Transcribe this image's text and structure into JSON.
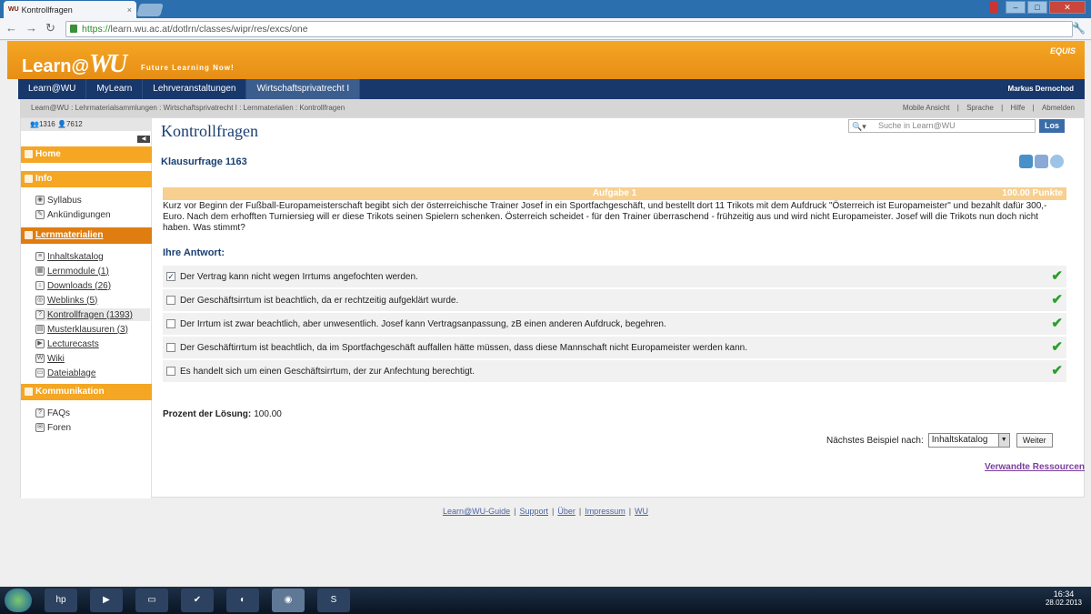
{
  "browser": {
    "tab_title": "Kontrollfragen",
    "tab_favicon": "WU",
    "url_scheme": "https://",
    "url_rest": "learn.wu.ac.at/dotlrn/classes/wipr/res/excs/one"
  },
  "header": {
    "logo_left": "Learn@",
    "logo_wu": "WU",
    "tagline": "Future Learning Now!",
    "equis": "EQUIS"
  },
  "mainnav": {
    "items": [
      "Learn@WU",
      "MyLearn",
      "Lehrveranstaltungen",
      "Wirtschaftsprivatrecht I"
    ],
    "user": "Markus Dernochod"
  },
  "breadcrumb": {
    "path": "Learn@WU : Lehrmaterialsammlungen : Wirtschaftsprivatrecht I : Lernmaterialien : Kontrollfragen",
    "links": [
      "Mobile Ansicht",
      "|",
      "Sprache",
      "|",
      "Hilfe",
      "|",
      "Abmelden"
    ]
  },
  "sidebar": {
    "counts": "👥1316  👤7612",
    "home": "Home",
    "info": "Info",
    "info_items": [
      "Syllabus",
      "Ankündigungen"
    ],
    "lern": "Lernmaterialien",
    "lern_items": [
      "Inhaltskatalog",
      "Lernmodule (1)",
      "Downloads (26)",
      "Weblinks (5)",
      "Kontrollfragen (1393)",
      "Musterklausuren (3)",
      "Lecturecasts",
      "Wiki",
      "Dateiablage"
    ],
    "komm": "Kommunikation",
    "komm_items": [
      "FAQs",
      "Foren"
    ]
  },
  "main": {
    "title": "Kontrollfragen",
    "search_placeholder": "Suche in Learn@WU",
    "search_button": "Los",
    "question_title": "Klausurfrage 1163",
    "aufgabe": "Aufgabe 1",
    "punkte": "100.00 Punkte",
    "question_text": "Kurz vor Beginn der Fußball-Europameisterschaft begibt sich der österreichische Trainer Josef in ein Sportfachgeschäft, und bestellt dort 11 Trikots mit dem Aufdruck \"Österreich ist Europameister\" und bezahlt dafür 300,- Euro. Nach dem erhofften Turniersieg will er diese Trikots seinen Spielern schenken. Österreich scheidet - für den Trainer überraschend - frühzeitig aus und wird nicht Europameister. Josef will die Trikots nun doch nicht haben. Was stimmt?",
    "ihre_antwort": "Ihre Antwort:",
    "answers": [
      {
        "text": "Der Vertrag kann nicht wegen Irrtums angefochten werden.",
        "checked": true
      },
      {
        "text": "Der Geschäftsirrtum ist beachtlich, da er rechtzeitig aufgeklärt wurde.",
        "checked": false
      },
      {
        "text": "Der Irrtum ist zwar beachtlich, aber unwesentlich. Josef kann Vertragsanpassung, zB einen anderen Aufdruck, begehren.",
        "checked": false
      },
      {
        "text": "Der Geschäftirrtum ist beachtlich, da im Sportfachgeschäft auffallen hätte müssen, dass diese Mannschaft nicht Europameister werden kann.",
        "checked": false
      },
      {
        "text": "Es handelt sich um einen Geschäftsirrtum, der zur Anfechtung berechtigt.",
        "checked": false
      }
    ],
    "prozent_label": "Prozent der Lösung:",
    "prozent_value": "100.00",
    "next_label": "Nächstes Beispiel nach:",
    "next_select": "Inhaltskatalog",
    "weiter": "Weiter",
    "related": "Verwandte Ressourcen"
  },
  "footer": {
    "links": [
      "Learn@WU-Guide",
      "Support",
      "Über",
      "Impressum",
      "WU"
    ]
  },
  "taskbar": {
    "time": "16:34",
    "date": "28.02.2013"
  }
}
